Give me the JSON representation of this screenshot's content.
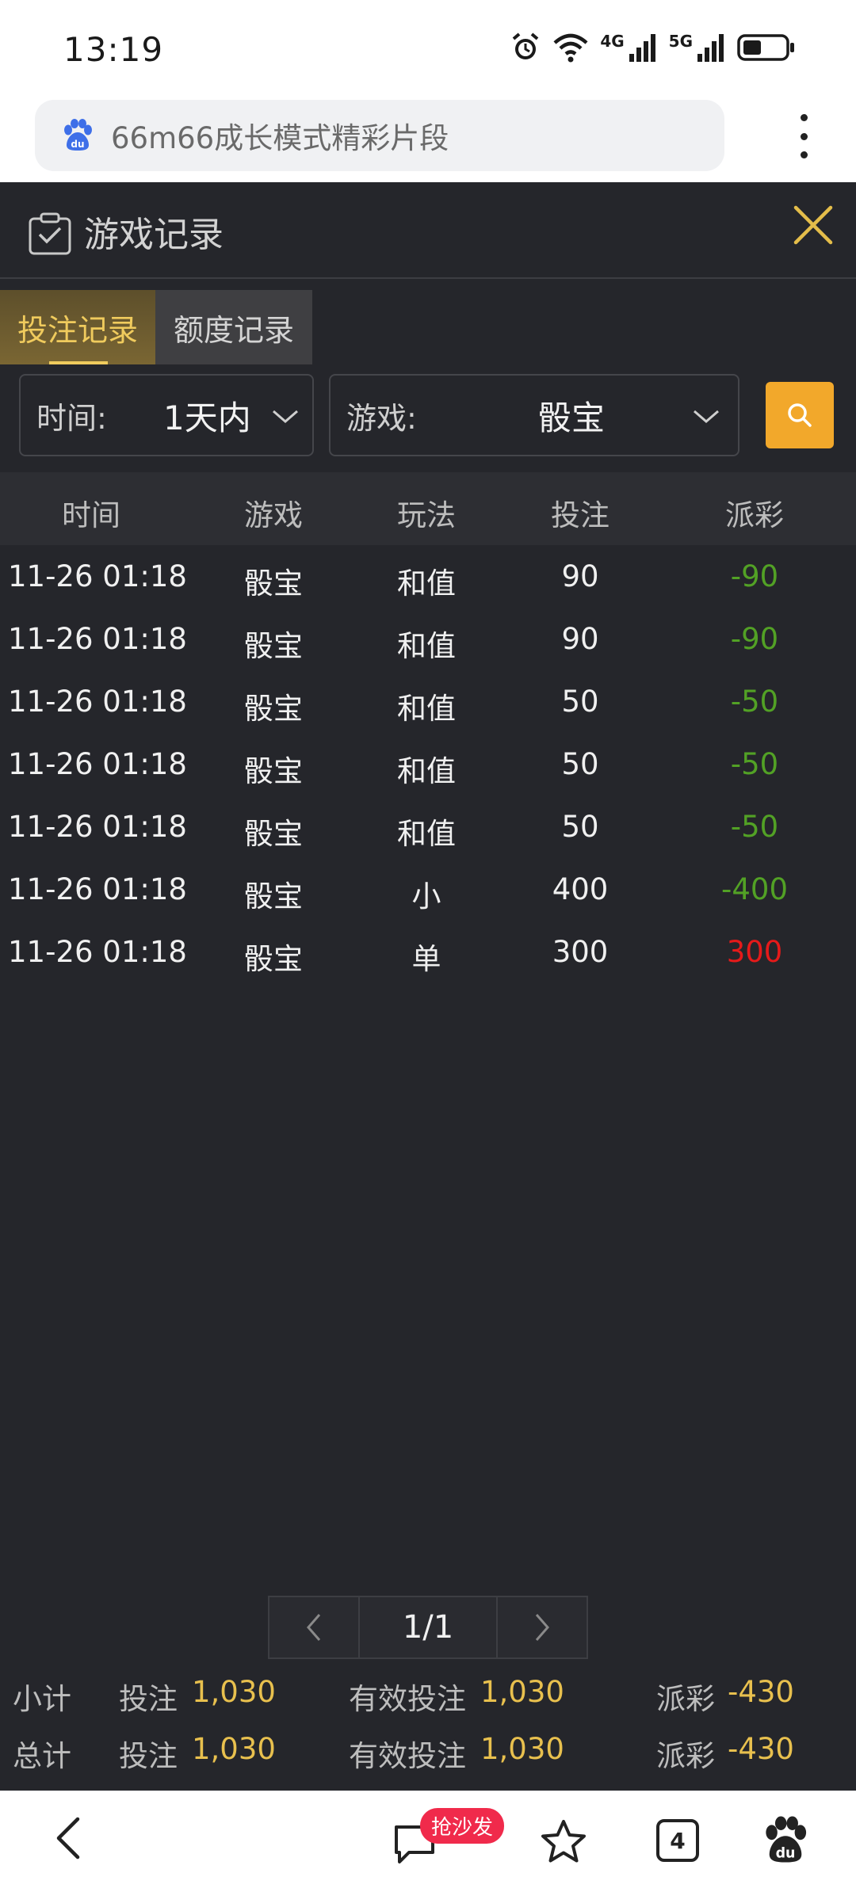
{
  "status_bar": {
    "time": "13:19",
    "net1": "4G",
    "net2": "5G"
  },
  "browser": {
    "url_text": "66m66成长模式精彩片段"
  },
  "header": {
    "title": "游戏记录"
  },
  "tabs": [
    {
      "label": "投注记录",
      "active": true
    },
    {
      "label": "额度记录",
      "active": false
    }
  ],
  "filters": {
    "time_label": "时间:",
    "time_value": "1天内",
    "game_label": "游戏:",
    "game_value": "骰宝"
  },
  "table": {
    "headers": [
      "时间",
      "游戏",
      "玩法",
      "投注",
      "派彩"
    ],
    "rows": [
      {
        "time": "11-26 01:18",
        "game": "骰宝",
        "play": "和值",
        "bet": "90",
        "payout": "-90",
        "payout_color": "#52a125"
      },
      {
        "time": "11-26 01:18",
        "game": "骰宝",
        "play": "和值",
        "bet": "90",
        "payout": "-90",
        "payout_color": "#52a125"
      },
      {
        "time": "11-26 01:18",
        "game": "骰宝",
        "play": "和值",
        "bet": "50",
        "payout": "-50",
        "payout_color": "#52a125"
      },
      {
        "time": "11-26 01:18",
        "game": "骰宝",
        "play": "和值",
        "bet": "50",
        "payout": "-50",
        "payout_color": "#52a125"
      },
      {
        "time": "11-26 01:18",
        "game": "骰宝",
        "play": "和值",
        "bet": "50",
        "payout": "-50",
        "payout_color": "#52a125"
      },
      {
        "time": "11-26 01:18",
        "game": "骰宝",
        "play": "小",
        "bet": "400",
        "payout": "-400",
        "payout_color": "#52a125"
      },
      {
        "time": "11-26 01:18",
        "game": "骰宝",
        "play": "单",
        "bet": "300",
        "payout": "300",
        "payout_color": "#e51a1a"
      }
    ]
  },
  "pagination": {
    "page": "1/1"
  },
  "summary": {
    "subtotal": {
      "label": "小计",
      "bet_label": "投注",
      "bet": "1,030",
      "valid_label": "有效投注",
      "valid": "1,030",
      "payout_label": "派彩",
      "payout": "-430"
    },
    "total": {
      "label": "总计",
      "bet_label": "投注",
      "bet": "1,030",
      "valid_label": "有效投注",
      "valid": "1,030",
      "payout_label": "派彩",
      "payout": "-430"
    }
  },
  "bottom_nav": {
    "badge": "抢沙发",
    "tab_count": "4"
  },
  "colors": {
    "accent": "#f0cb5d",
    "search_button": "#f2a82b",
    "loss": "#52a125",
    "win": "#e51a1a",
    "background": "#25262b"
  }
}
